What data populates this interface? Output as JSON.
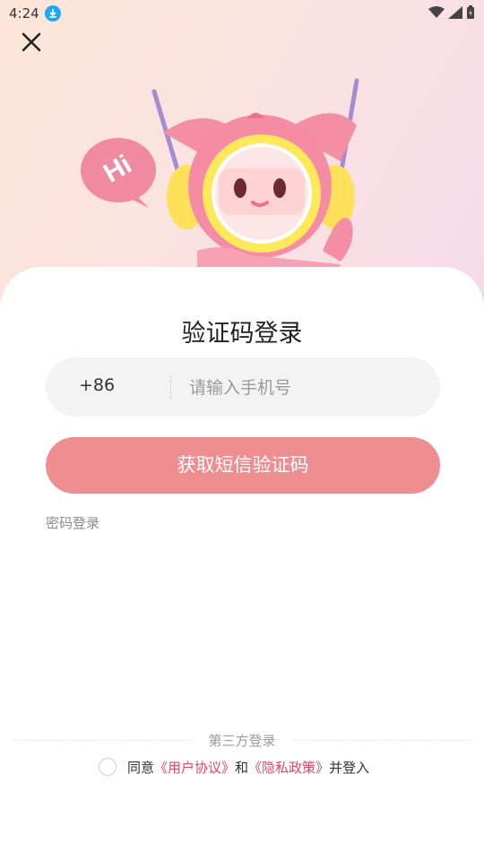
{
  "status_bar": {
    "time": "4:24"
  },
  "speech_bubble": {
    "text": "Hi"
  },
  "login": {
    "title": "验证码登录",
    "country_code": "+86",
    "phone_placeholder": "请输入手机号",
    "sms_button": "获取短信验证码",
    "password_login": "密码登录"
  },
  "third_party": {
    "label": "第三方登录"
  },
  "agreement": {
    "prefix": "同意",
    "user_agreement": "《用户协议》",
    "and": "和",
    "privacy_policy": "《隐私政策》",
    "suffix": "并登入"
  },
  "colors": {
    "primary_button": "#ef8e91",
    "link": "#e24a61"
  }
}
